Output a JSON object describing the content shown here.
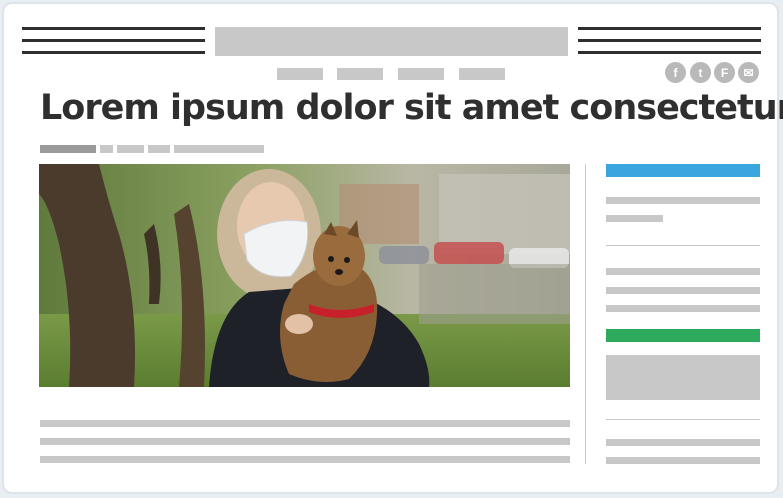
{
  "headline": "Lorem ipsum dolor sit amet consectetur",
  "social_icons": [
    {
      "name": "facebook-icon",
      "glyph": "f"
    },
    {
      "name": "twitter-icon",
      "glyph": "t"
    },
    {
      "name": "flipboard-icon",
      "glyph": "F"
    },
    {
      "name": "email-icon",
      "glyph": "✉"
    }
  ],
  "colors": {
    "accent_blue": "#3aa6e0",
    "accent_green": "#2eaa5c",
    "placeholder_gray": "#c8c8c8",
    "text_dark": "#2f2f2f"
  },
  "image": {
    "subject": "photo-woman-with-mask-holding-yorkshire-terrier"
  }
}
